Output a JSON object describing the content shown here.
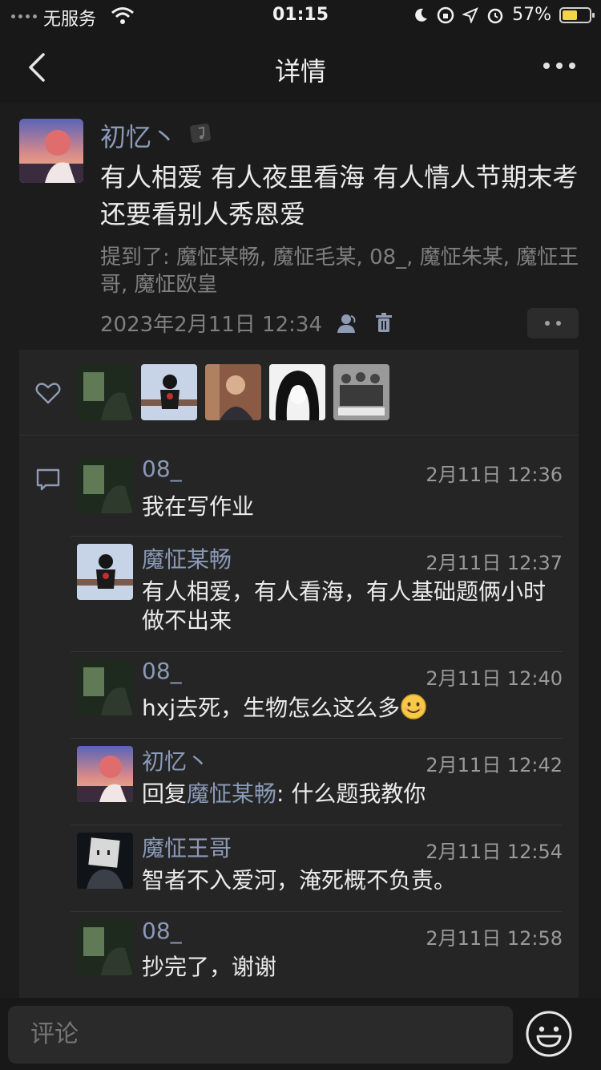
{
  "status_bar": {
    "carrier": "无服务",
    "time": "01:15",
    "battery": "57%",
    "battery_level": 0.57
  },
  "nav": {
    "title": "详情"
  },
  "post": {
    "author": "初忆丶",
    "text": "有人相爱 有人夜里看海 有人情人节期末考还要看别人秀恩爱",
    "mentions": "提到了: 魔怔某畅, 魔怔毛某, 08_, 魔怔朱某, 魔怔王哥, 魔怔欧皇",
    "date": "2023年2月11日 12:34"
  },
  "comments": [
    {
      "name": "08_",
      "time": "2月11日 12:36",
      "text": "我在写作业"
    },
    {
      "name": "魔怔某畅",
      "time": "2月11日 12:37",
      "text": "有人相爱，有人看海，有人基础题俩小时做不出来"
    },
    {
      "name": "08_",
      "time": "2月11日 12:40",
      "text": "hxj去死，生物怎么这么多"
    },
    {
      "name": "初忆丶",
      "time": "2月11日 12:42",
      "reply_prefix": "回复",
      "reply_to": "魔怔某畅",
      "text": ": 什么题我教你"
    },
    {
      "name": "魔怔王哥",
      "time": "2月11日 12:54",
      "text": "智者不入爱河，淹死概不负责。"
    },
    {
      "name": "08_",
      "time": "2月11日 12:58",
      "text": "抄完了，谢谢"
    }
  ],
  "comment_box": {
    "placeholder": "评论"
  },
  "colors": {
    "background": "#1c1c1c",
    "panel": "#252525",
    "name_link": "#8b9ab8",
    "battery_fill": "#f4d34a"
  }
}
